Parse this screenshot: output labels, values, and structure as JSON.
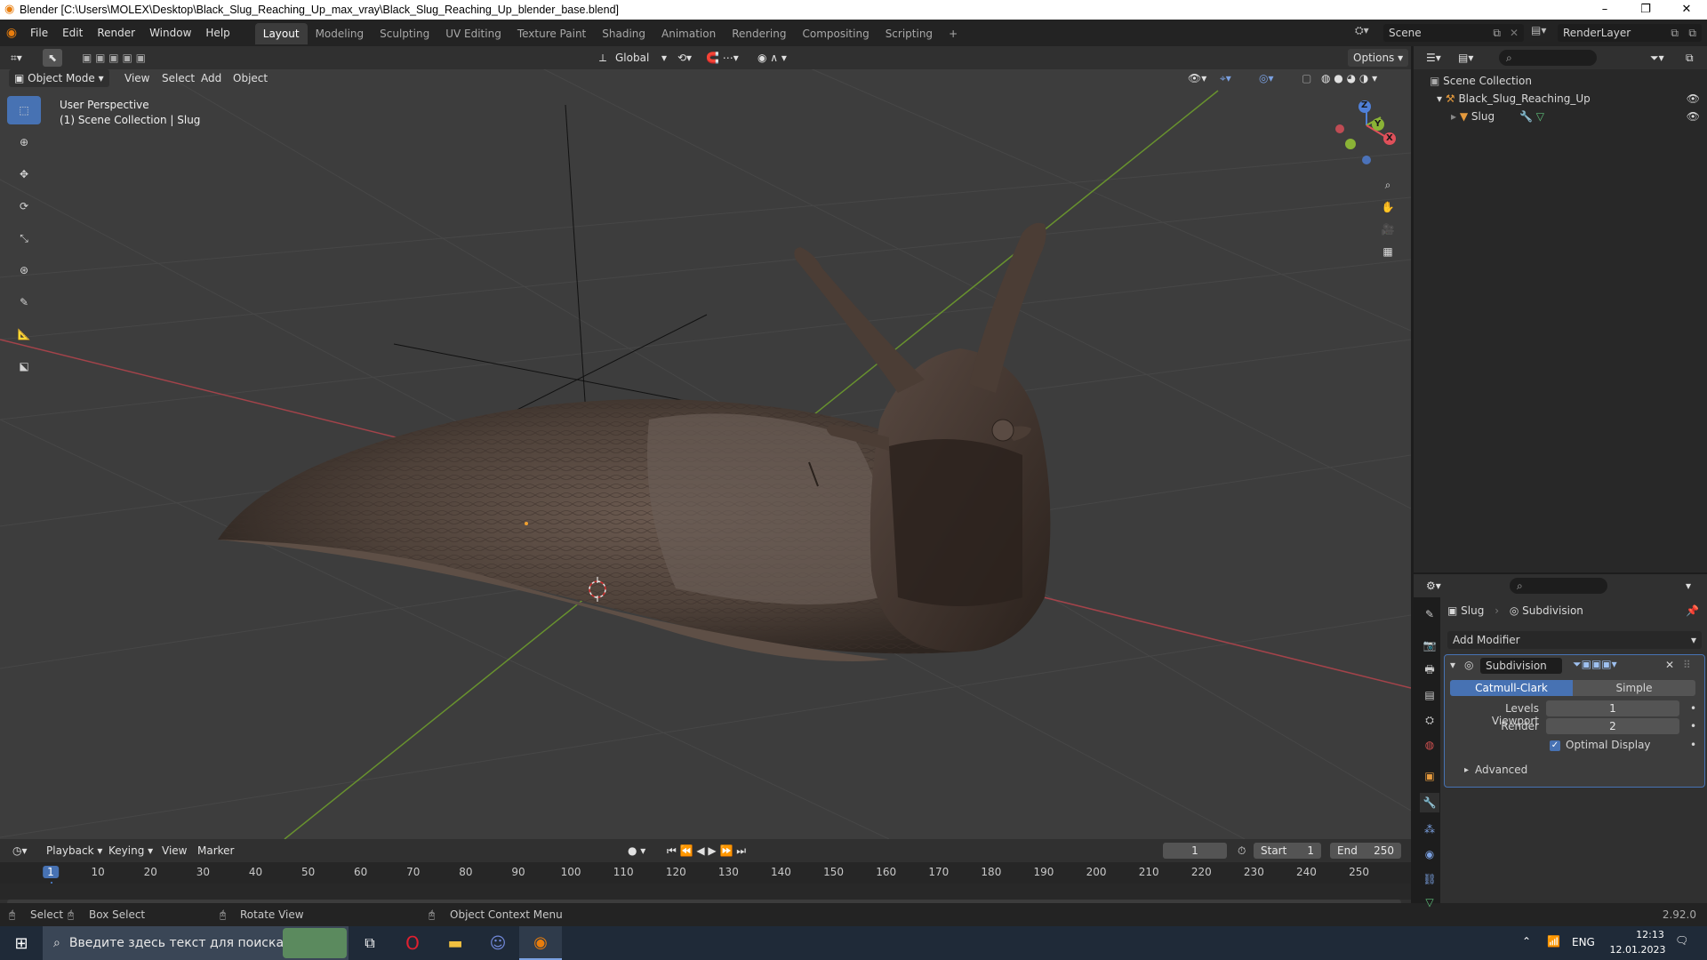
{
  "window": {
    "title": "Blender [C:\\Users\\MOLEX\\Desktop\\Black_Slug_Reaching_Up_max_vray\\Black_Slug_Reaching_Up_blender_base.blend]",
    "minimize": "–",
    "maximize": "❐",
    "close": "✕"
  },
  "menubar": {
    "items": [
      "File",
      "Edit",
      "Render",
      "Window",
      "Help"
    ]
  },
  "workspaces": [
    "Layout",
    "Modeling",
    "Sculpting",
    "UV Editing",
    "Texture Paint",
    "Shading",
    "Animation",
    "Rendering",
    "Compositing",
    "Scripting"
  ],
  "workspace_add": "+",
  "scene": {
    "name": "Scene",
    "layer": "RenderLayer"
  },
  "viewport": {
    "transform_orientation": "Global",
    "options": "Options",
    "mode": "Object Mode",
    "menus": [
      "View",
      "Select",
      "Add",
      "Object"
    ],
    "overlay_text_1": "User Perspective",
    "overlay_text_2": "(1) Scene Collection | Slug"
  },
  "gizmo": {
    "z": "Z",
    "y": "Y",
    "x": "X"
  },
  "timeline": {
    "menus": [
      "Playback",
      "Keying",
      "View",
      "Marker"
    ],
    "current_frame": "1",
    "start_label": "Start",
    "start": "1",
    "end_label": "End",
    "end": "250",
    "ticks": [
      "1",
      "10",
      "20",
      "30",
      "40",
      "50",
      "60",
      "70",
      "80",
      "90",
      "100",
      "110",
      "120",
      "130",
      "140",
      "150",
      "160",
      "170",
      "180",
      "190",
      "200",
      "210",
      "220",
      "230",
      "240",
      "250"
    ]
  },
  "statusbar": {
    "select": "Select",
    "box_select": "Box Select",
    "rotate_view": "Rotate View",
    "context_menu": "Object Context Menu",
    "version": "2.92.0"
  },
  "outliner": {
    "root": "Scene Collection",
    "items": [
      {
        "name": "Black_Slug_Reaching_Up"
      },
      {
        "name": "Slug"
      }
    ]
  },
  "properties": {
    "object": "Slug",
    "modifier_crumb": "Subdivision",
    "add_modifier": "Add Modifier",
    "modifier_name": "Subdivision",
    "catmull": "Catmull-Clark",
    "simple": "Simple",
    "levels_viewport_label": "Levels Viewport",
    "levels_viewport": "1",
    "render_label": "Render",
    "render": "2",
    "optimal_display": "Optimal Display",
    "advanced": "Advanced"
  },
  "taskbar": {
    "search_placeholder": "Введите здесь текст для поиска",
    "lang": "ENG",
    "time": "12:13",
    "date": "12.01.2023"
  },
  "colors": {
    "accent": "#4772b3",
    "x_axis": "#c8464e",
    "y_axis": "#6ea22e",
    "bg": "#3d3d3d"
  }
}
